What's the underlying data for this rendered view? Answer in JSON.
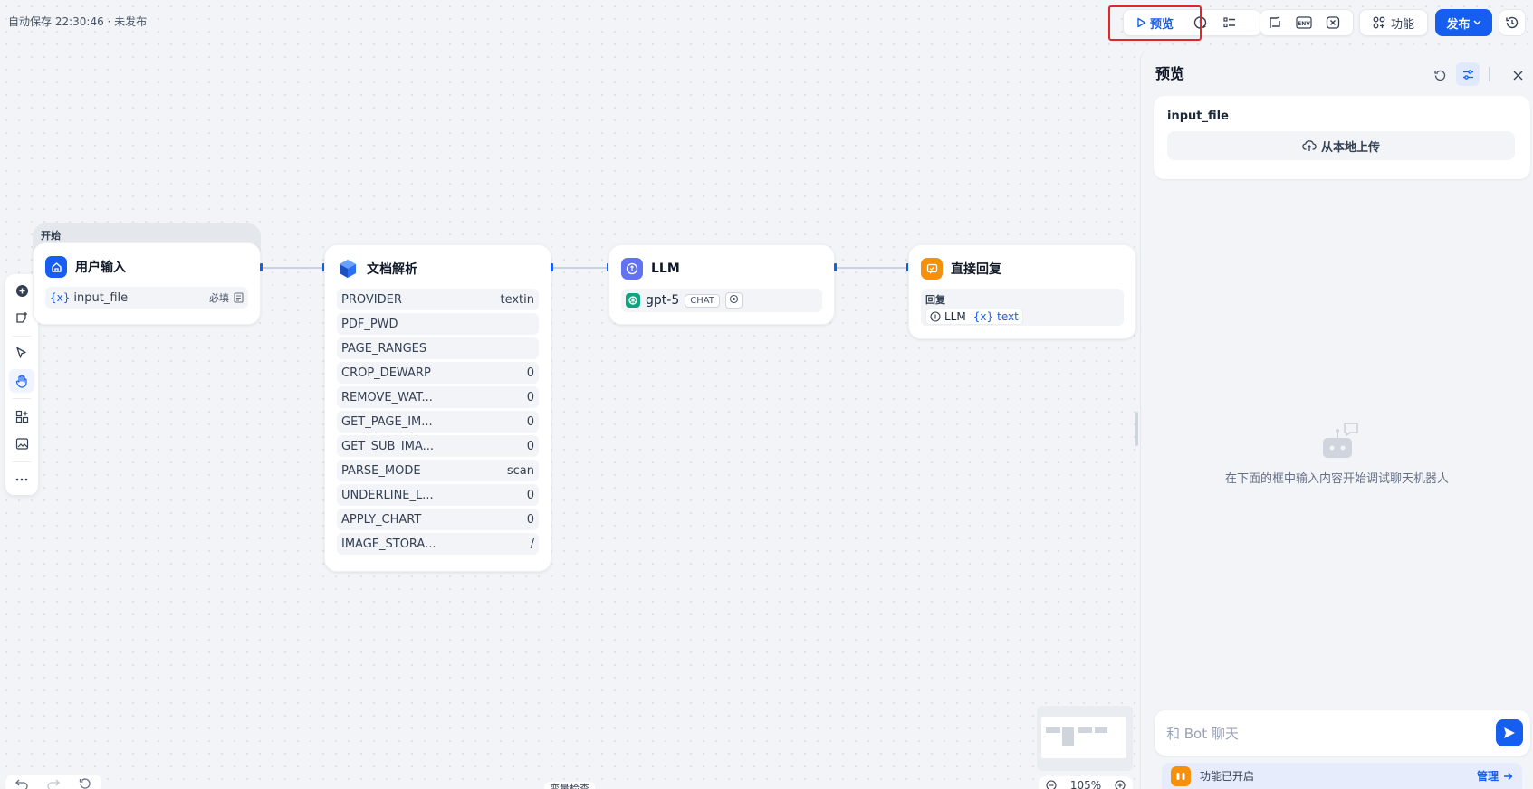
{
  "header": {
    "autosave": "自动保存 22:30:46 · 未发布",
    "preview_label": "预览",
    "features_label": "功能",
    "publish_label": "发布"
  },
  "nodes": {
    "start": {
      "tag": "开始",
      "title": "用户输入",
      "variable": "input_file",
      "var_prefix": "{x}",
      "required_label": "必填"
    },
    "doc_parse": {
      "title": "文档解析",
      "params": [
        {
          "name": "PROVIDER",
          "value": "textin"
        },
        {
          "name": "PDF_PWD",
          "value": ""
        },
        {
          "name": "PAGE_RANGES",
          "value": ""
        },
        {
          "name": "CROP_DEWARP",
          "value": "0"
        },
        {
          "name": "REMOVE_WAT...",
          "value": "0"
        },
        {
          "name": "GET_PAGE_IM...",
          "value": "0"
        },
        {
          "name": "GET_SUB_IMA...",
          "value": "0"
        },
        {
          "name": "PARSE_MODE",
          "value": "scan"
        },
        {
          "name": "UNDERLINE_L...",
          "value": "0"
        },
        {
          "name": "APPLY_CHART",
          "value": "0"
        },
        {
          "name": "IMAGE_STORA...",
          "value": "/"
        }
      ]
    },
    "llm": {
      "title": "LLM",
      "model": "gpt-5",
      "mode_badge": "CHAT"
    },
    "reply": {
      "title": "直接回复",
      "reply_label": "回复",
      "ref_node": "LLM",
      "ref_var": "text",
      "var_prefix": "{x}"
    }
  },
  "panel": {
    "title": "预览",
    "input_label": "input_file",
    "upload_label": "从本地上传",
    "empty_text": "在下面的框中输入内容开始调试聊天机器人",
    "chat_placeholder": "和 Bot 聊天",
    "feature_status": "功能已开启",
    "manage_label": "管理"
  },
  "footer": {
    "zoom": "105%",
    "var_check": "变量检查"
  },
  "colors": {
    "accent": "#155eef",
    "highlight": "#e5242a",
    "reply_icon": "#f79009",
    "llm_icon": "#6172f3",
    "openai_green": "#10a37f"
  }
}
